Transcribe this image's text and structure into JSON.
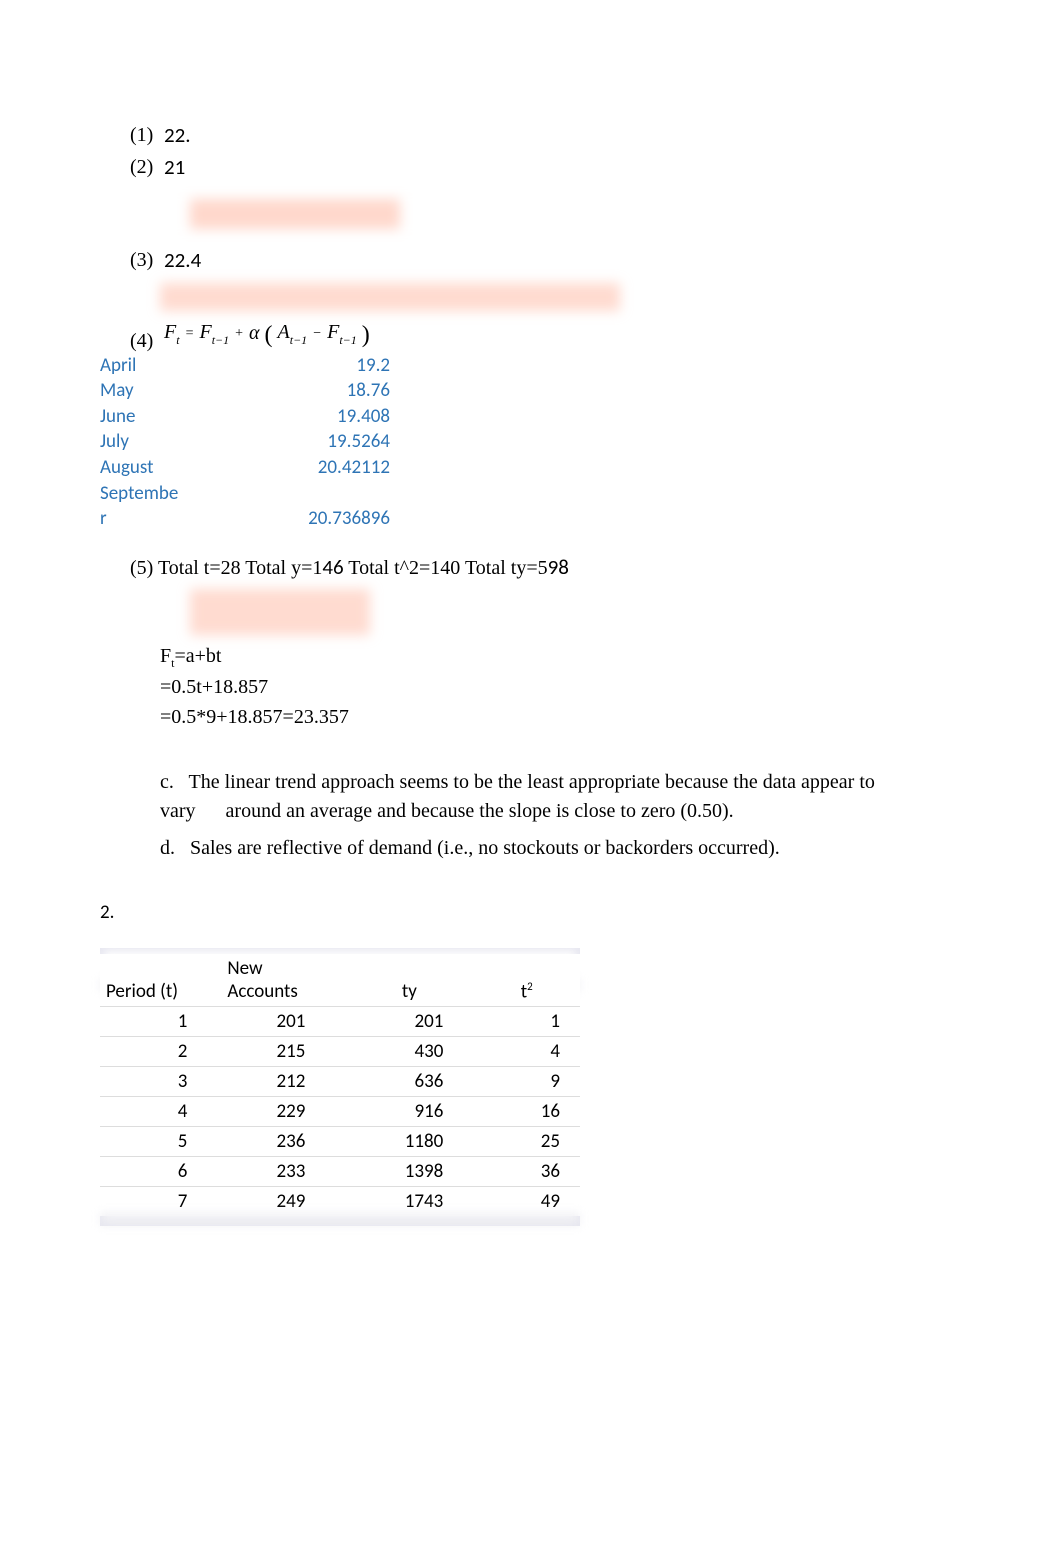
{
  "section1": {
    "item1": {
      "num": "(1)",
      "val": "22."
    },
    "item2": {
      "num": "(2)",
      "val": "21"
    },
    "item3": {
      "num": "(3)",
      "val": "22.4"
    },
    "item4_num": "(4)",
    "formula_parts": {
      "F": "F",
      "t": "t",
      "eq_top": "=",
      "eq_bot": "",
      "tm1": "t−1",
      "plus_top": "+",
      "alpha": "α",
      "A": "A",
      "minus": "−"
    }
  },
  "months": [
    {
      "name": "April",
      "val": "19.2"
    },
    {
      "name": "May",
      "val": "18.76"
    },
    {
      "name": "June",
      "val": "19.408"
    },
    {
      "name": "July",
      "val": "19.5264"
    },
    {
      "name": "August",
      "val": "20.42112"
    },
    {
      "name": "September",
      "val": "20.736896"
    }
  ],
  "item5": {
    "num": "(5)",
    "text": "Total t=28  Total y=146  Total t^2=140  Total ty=598",
    "text_parts": {
      "a": "Total t=28  Total y=1",
      "b": "46",
      "c": "  Total t^2=140  Total ty=5",
      "d": "98"
    }
  },
  "ft_block": {
    "l1": "Fₜ=a+bt",
    "l1_plain_pre": "F",
    "l1_sub": "t",
    "l1_rest": "=a+bt",
    "l2": "=0.5t+18.857",
    "l3": "=0.5*9+18.857=23.357"
  },
  "para_c": {
    "label": "c.",
    "body1": "The linear trend approach seems to be the least appropriate because the data appear to",
    "body2_pre": "vary",
    "body2_rest": "around an average and because the slope is close to zero (0.50)."
  },
  "para_d": {
    "label": "d.",
    "body": "Sales are reflective of demand (i.e., no stockouts or backorders occurred)."
  },
  "q2_label": "2.",
  "chart_data": {
    "type": "table",
    "title": "",
    "columns": [
      "Period (t)",
      "New Accounts",
      "ty",
      "t²"
    ],
    "rows": [
      [
        1,
        201,
        201,
        1
      ],
      [
        2,
        215,
        430,
        4
      ],
      [
        3,
        212,
        636,
        9
      ],
      [
        4,
        229,
        916,
        16
      ],
      [
        5,
        236,
        1180,
        25
      ],
      [
        6,
        233,
        1398,
        36
      ],
      [
        7,
        249,
        1743,
        49
      ]
    ]
  }
}
